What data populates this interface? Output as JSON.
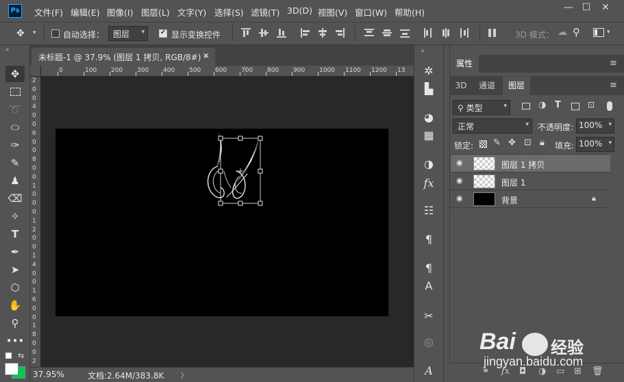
{
  "app": {
    "logo_text": "Ps",
    "menu": [
      "文件(F)",
      "编辑(E)",
      "图像(I)",
      "图层(L)",
      "文字(Y)",
      "选择(S)",
      "滤镜(T)",
      "3D(D)",
      "视图(V)",
      "窗口(W)",
      "帮助(H)"
    ],
    "window_controls": {
      "minimize": "—",
      "maximize": "☐",
      "close": "✕"
    }
  },
  "options_bar": {
    "auto_select_label": "自动选择：",
    "auto_select_target": "图层",
    "show_transform_label": "显示变换控件",
    "mode_3d_label": "3D 模式："
  },
  "document": {
    "tab_title": "未标题-1 @ 37.9% (图层 1 拷贝, RGB/8#) *",
    "close_glyph": "×",
    "ruler_top": [
      "0",
      "100",
      "200",
      "300",
      "400",
      "500",
      "600",
      "700",
      "800",
      "900",
      "1000",
      "1100",
      "1200",
      "13"
    ],
    "ruler_left": [
      "2",
      "0",
      "0",
      "4",
      "0",
      "0",
      "6",
      "0",
      "0",
      "8",
      "0",
      "0",
      "1",
      "0",
      "0",
      "0",
      "1",
      "2",
      "0",
      "0",
      "1",
      "4",
      "0",
      "0",
      "1",
      "6",
      "0",
      "0",
      "1",
      "8",
      "0",
      "0",
      "2"
    ]
  },
  "status": {
    "zoom": "37.95%",
    "doc_info": "文档:2.64M/383.8K",
    "arrow": "〉"
  },
  "panels": {
    "properties_tab": "属性",
    "tabs": [
      "3D",
      "通道",
      "图层"
    ],
    "active_tab": "图层",
    "filter_kind": "类型",
    "blend_mode": "正常",
    "opacity_label": "不透明度:",
    "opacity_value": "100%",
    "lock_label": "锁定:",
    "fill_label": "填充:",
    "fill_value": "100%",
    "layers": [
      {
        "name": "图层 1 拷贝",
        "selected": true,
        "thumb": "transparent"
      },
      {
        "name": "图层 1",
        "selected": false,
        "thumb": "transparent"
      },
      {
        "name": "背景",
        "selected": false,
        "thumb": "black",
        "locked": true
      }
    ]
  },
  "watermark": {
    "brand": "Bai",
    "brand_suffix": "经验",
    "url": "jingyan.baidu.com"
  },
  "colors": {
    "ui_gray": "#535353",
    "canvas_bg": "#282828",
    "accent_blue": "#31a8ff",
    "foreground_swatch": "#ffffff",
    "background_swatch": "#00c853"
  }
}
